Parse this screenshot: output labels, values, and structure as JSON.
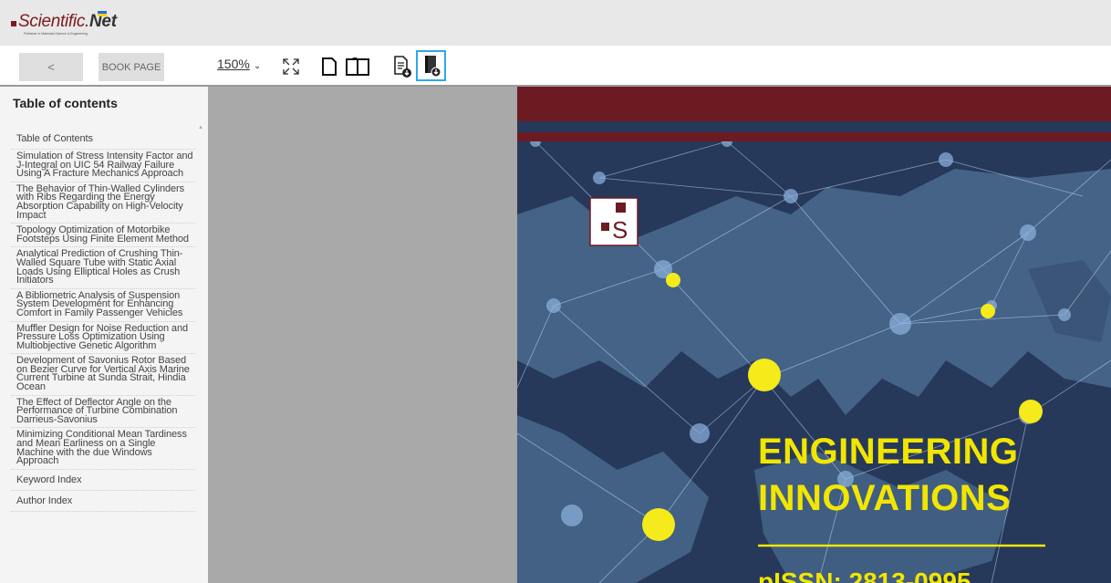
{
  "brand": {
    "logo_main": "Scientific.",
    "logo_net": "Net",
    "logo_sub": "Publisher in Materials Science & Engineering"
  },
  "toolbar": {
    "back_label": "<",
    "book_page_label": "BOOK PAGE",
    "zoom_value": "150%",
    "icons": [
      "fullscreen-icon",
      "single-page-icon",
      "two-page-icon",
      "download-page-icon",
      "download-book-icon"
    ]
  },
  "sidebar": {
    "title": "Table of contents",
    "items": [
      {
        "label": "Table of Contents"
      },
      {
        "label": "Simulation of Stress Intensity Factor and J-Integral on UIC 54 Railway Failure Using A Fracture Mechanics Approach"
      },
      {
        "label": "The Behavior of Thin-Walled Cylinders with Ribs Regarding the Energy Absorption Capability on High-Velocity Impact"
      },
      {
        "label": "Topology Optimization of Motorbike Footsteps Using Finite Element Method"
      },
      {
        "label": "Analytical Prediction of Crushing Thin-Walled Square Tube with Static Axial Loads Using Elliptical Holes as Crush Initiators"
      },
      {
        "label": "A Bibliometric Analysis of Suspension System Development for Enhancing Comfort in Family Passenger Vehicles"
      },
      {
        "label": "Muffler Design for Noise Reduction and Pressure Loss Optimization Using Multiobjective Genetic Algorithm"
      },
      {
        "label": "Development of Savonius Rotor Based on Bezier Curve for Vertical Axis Marine Current Turbine at Sunda Strait, Hindia Ocean"
      },
      {
        "label": "The Effect of Deflector Angle on the Performance of Turbine Combination Darrieus-Savonius"
      },
      {
        "label": "Minimizing Conditional Mean Tardiness and Mean Earliness on a Single Machine with the due Windows Approach"
      },
      {
        "label": "Keyword Index"
      },
      {
        "label": "Author Index"
      }
    ]
  },
  "cover": {
    "title_line1": "ENGINEERING",
    "title_line2": "INNOVATIONS",
    "issn": "pISSN: 2813-0995",
    "logo_letter": "S",
    "colors": {
      "band": "#6d1b22",
      "title": "#f2e600",
      "ocean": "#2a3d5a",
      "land": "#4d6f91",
      "node": "#f2e600"
    }
  },
  "colors": {
    "accent": "#2ea8e6",
    "brand": "#7a1a1f"
  }
}
